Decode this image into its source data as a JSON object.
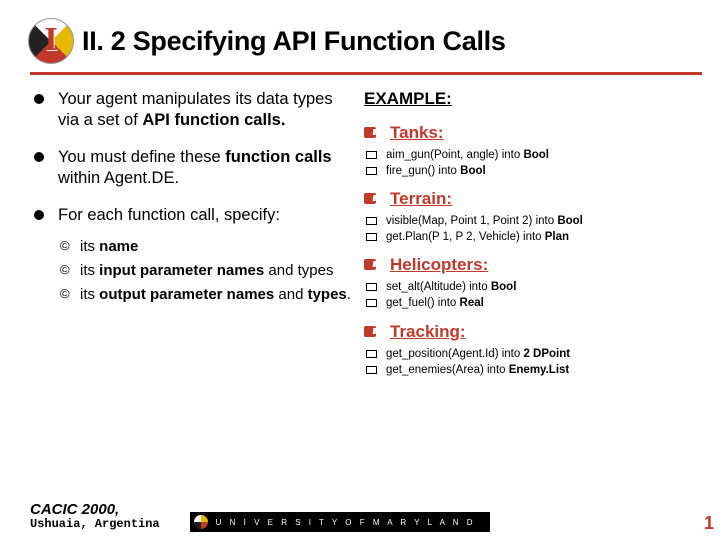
{
  "title": "II. 2  Specifying API Function Calls",
  "left": {
    "items": [
      {
        "html": "Your agent manipulates its data types via a set of <b>API function calls.</b>"
      },
      {
        "html": "You must define these <b>function calls</b> within Agent.DE."
      },
      {
        "html": "For each function call, specify:",
        "sub": [
          {
            "html": "its <b>name</b>"
          },
          {
            "html": "its <b>input parameter names</b> and types"
          },
          {
            "html": "its <b>output parameter names</b> and <b>types</b>."
          }
        ]
      }
    ]
  },
  "right": {
    "heading": "EXAMPLE:",
    "groups": [
      {
        "title": "Tanks:",
        "fns": [
          {
            "html": "aim_gun(Point, angle) into <b>Bool</b>"
          },
          {
            "html": "fire_gun() into <b>Bool</b>"
          }
        ]
      },
      {
        "title": "Terrain:",
        "fns": [
          {
            "html": "visible(Map, Point 1, Point 2) into <b>Bool</b>"
          },
          {
            "html": "get.Plan(P 1, P 2, Vehicle) into <b>Plan</b>"
          }
        ]
      },
      {
        "title": "Helicopters:",
        "fns": [
          {
            "html": "set_alt(Altitude) into <b>Bool</b>"
          },
          {
            "html": "get_fuel() into <b>Real</b>"
          }
        ]
      },
      {
        "title": "Tracking:",
        "fns": [
          {
            "html": "get_position(Agent.Id) into <b>2 DPoint</b>"
          },
          {
            "html": "get_enemies(Area) into <b>Enemy.List</b>"
          }
        ]
      }
    ]
  },
  "footer": {
    "conf1": "CACIC 2000,",
    "conf2": "Ushuaia, Argentina",
    "bar": "U N I V E R S I T Y   O F   M A R Y L A N D",
    "page": "1"
  }
}
